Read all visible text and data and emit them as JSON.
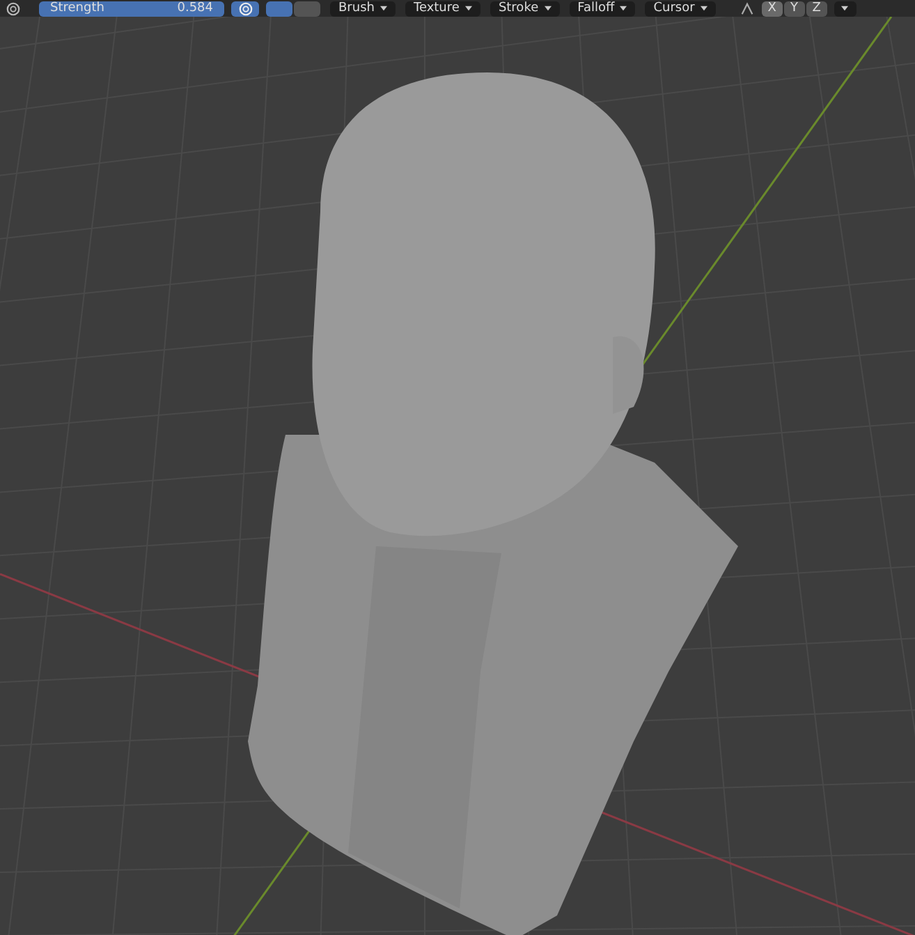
{
  "toolbar": {
    "strength": {
      "label": "Strength",
      "value": "0.584",
      "selected": true
    },
    "pressure_toggle": {
      "selected": true
    },
    "toggles": [
      {
        "selected": true
      },
      {
        "selected": false
      }
    ],
    "menus": [
      {
        "label": "Brush"
      },
      {
        "label": "Texture"
      },
      {
        "label": "Stroke"
      },
      {
        "label": "Falloff"
      },
      {
        "label": "Cursor"
      }
    ],
    "axes": [
      {
        "label": "X",
        "selected": true
      },
      {
        "label": "Y",
        "selected": false
      },
      {
        "label": "Z",
        "selected": false
      }
    ]
  },
  "viewport": {
    "kind": "sculpt"
  }
}
